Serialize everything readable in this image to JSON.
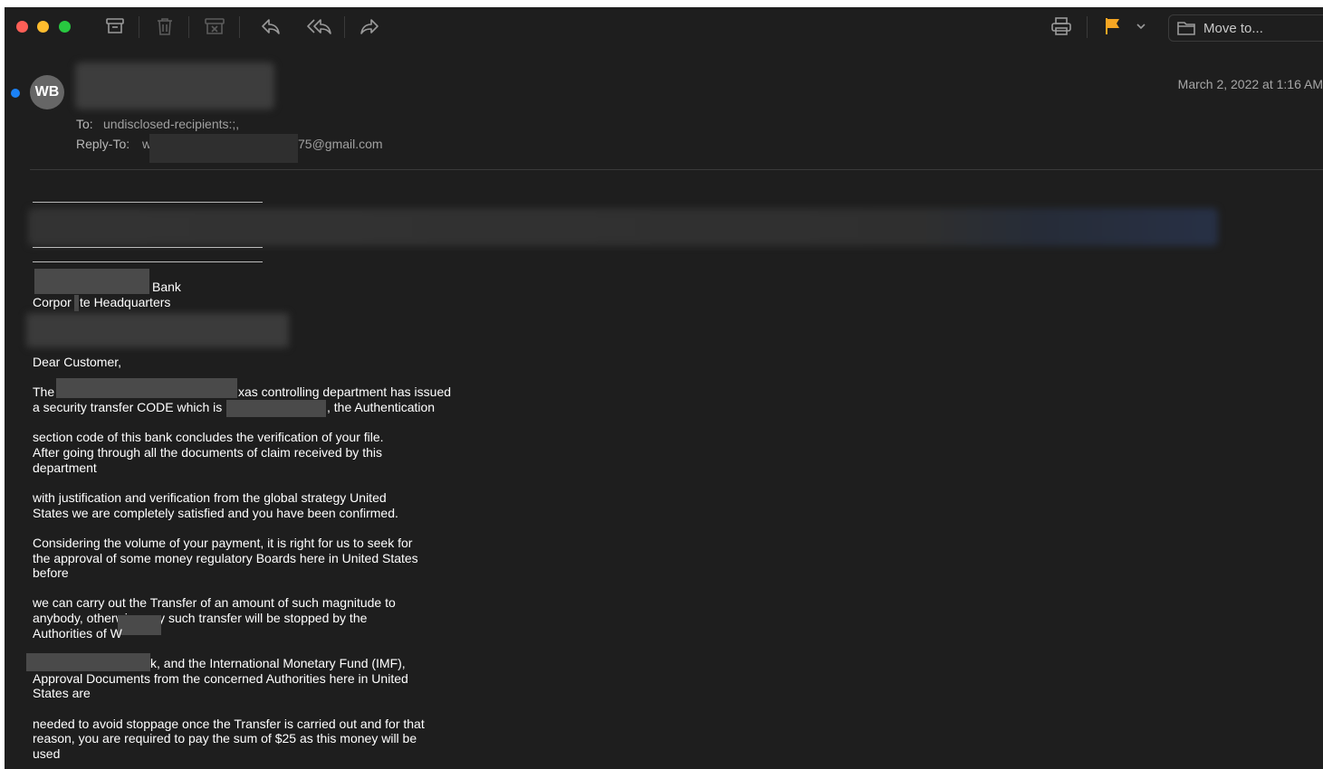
{
  "toolbar": {
    "icons": [
      "archive-icon",
      "trash-icon",
      "junk-icon",
      "reply-icon",
      "reply-all-icon",
      "forward-icon",
      "print-icon",
      "flag-icon",
      "chevron-down-icon",
      "folder-icon"
    ],
    "flag_color": "#f5a623",
    "move_to_label": "Move to..."
  },
  "header": {
    "avatar_initials": "WB",
    "date": "March 2, 2022 at 1:16 AM",
    "to_label": "To:",
    "to_value": "undisclosed-recipients:;,",
    "reply_to_label": "Reply-To:",
    "reply_to_prefix": "w",
    "reply_to_suffix": "75@gmail.com",
    "unread_color": "#1b82f7"
  },
  "body": {
    "bank_suffix": "Bank",
    "hq_prefix": "Corpor",
    "hq_suffix": "te Headquarters",
    "greeting": "Dear Customer,",
    "p1_l1_start": "The",
    "p1_l1_end": "xas controlling department has issued",
    "p1_l2_start": "a security transfer CODE which is",
    "p1_l2_end": ", the Authentication",
    "p2": [
      "section code of this bank concludes the verification of your file.",
      "After going through all the documents of claim received by this",
      "department"
    ],
    "p3": [
      "with justification and verification from the global strategy United",
      "States we are completely satisfied and you have been confirmed."
    ],
    "p4": [
      "Considering the volume of your payment, it is right for us to seek for",
      "the approval of some money regulatory Boards here in United States",
      "before"
    ],
    "p5_l1": "we can carry out the Transfer of an amount of such magnitude to",
    "p5_l2": "anybody, otherwise any such transfer will be stopped by the",
    "p5_l3": "Authorities of W",
    "p6_l1": "k, and the International Monetary Fund (IMF),",
    "p6_l2": "Approval Documents from the concerned Authorities here in United",
    "p6_l3": "States are",
    "p7": [
      "needed to avoid stoppage once the Transfer is carried out and for that",
      "reason, you are required to pay the sum of $25 as this money will be",
      "used"
    ]
  }
}
